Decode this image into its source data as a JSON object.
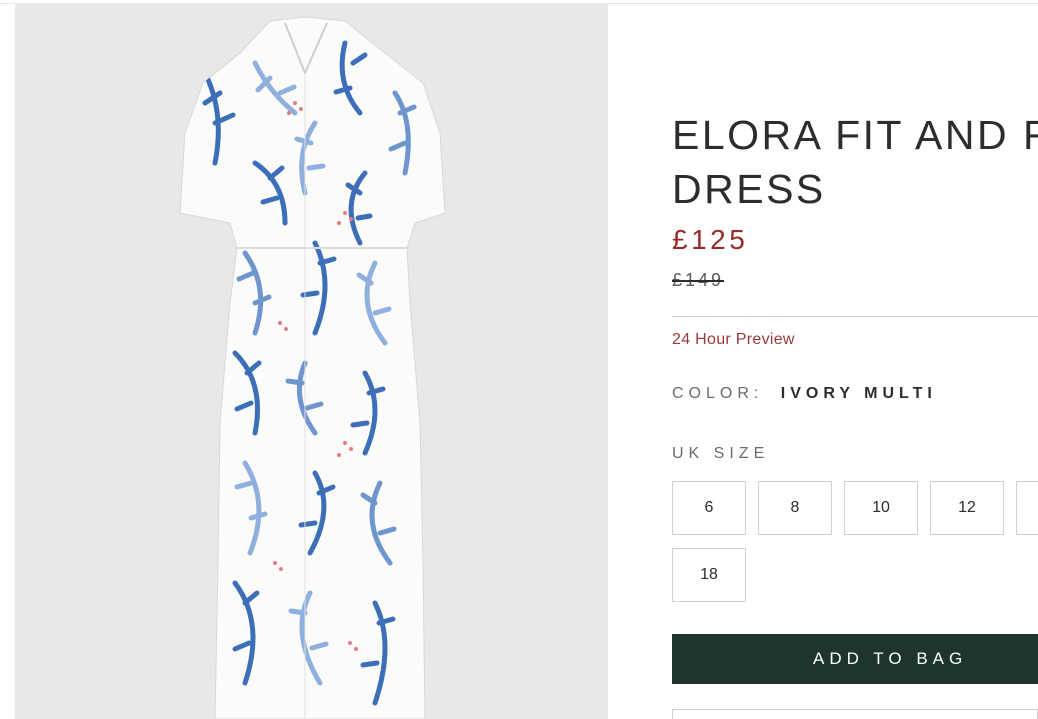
{
  "product": {
    "image_alt": "Ivory multi printed shirt dress",
    "title": "ELORA FIT AND FLARE DRESS",
    "price_now": "£125",
    "price_was": "£149",
    "preview_text": "24 Hour Preview",
    "color_label": "COLOR:",
    "color_value": "IVORY MULTI",
    "size_label": "UK SIZE",
    "sizes": [
      "6",
      "8",
      "10",
      "12",
      "",
      "18"
    ],
    "add_to_bag": "ADD TO BAG"
  },
  "colors": {
    "accent_price": "#9a2a2a",
    "button_bg": "#1d342f",
    "image_bg": "#e8e8e8",
    "print_blue": "#3d6fb8",
    "print_light_blue": "#8fb0de"
  }
}
